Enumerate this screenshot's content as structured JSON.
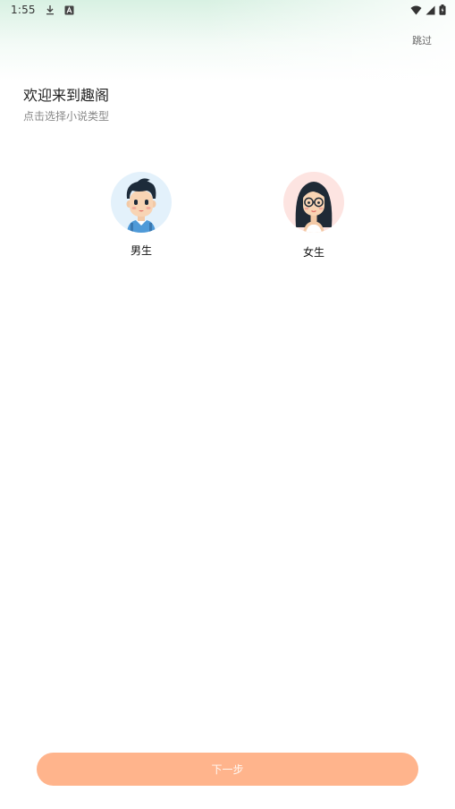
{
  "status_bar": {
    "time": "1:55",
    "left_icons": [
      "download-icon",
      "notification-a-icon"
    ],
    "right_icons": [
      "wifi-icon",
      "signal-icon",
      "battery-icon"
    ]
  },
  "header": {
    "skip_label": "跳过"
  },
  "intro": {
    "title": "欢迎来到趣阁",
    "subtitle": "点击选择小说类型"
  },
  "genders": [
    {
      "label": "男生",
      "avatar": "boy-avatar-icon",
      "background": "#e3f1fb"
    },
    {
      "label": "女生",
      "avatar": "girl-avatar-icon",
      "background": "#fde4e1"
    }
  ],
  "footer": {
    "next_label": "下一步",
    "button_color": "#ffb48c"
  },
  "colors": {
    "accent": "#ffb48c",
    "top_gradient": "#d6f0e1"
  }
}
